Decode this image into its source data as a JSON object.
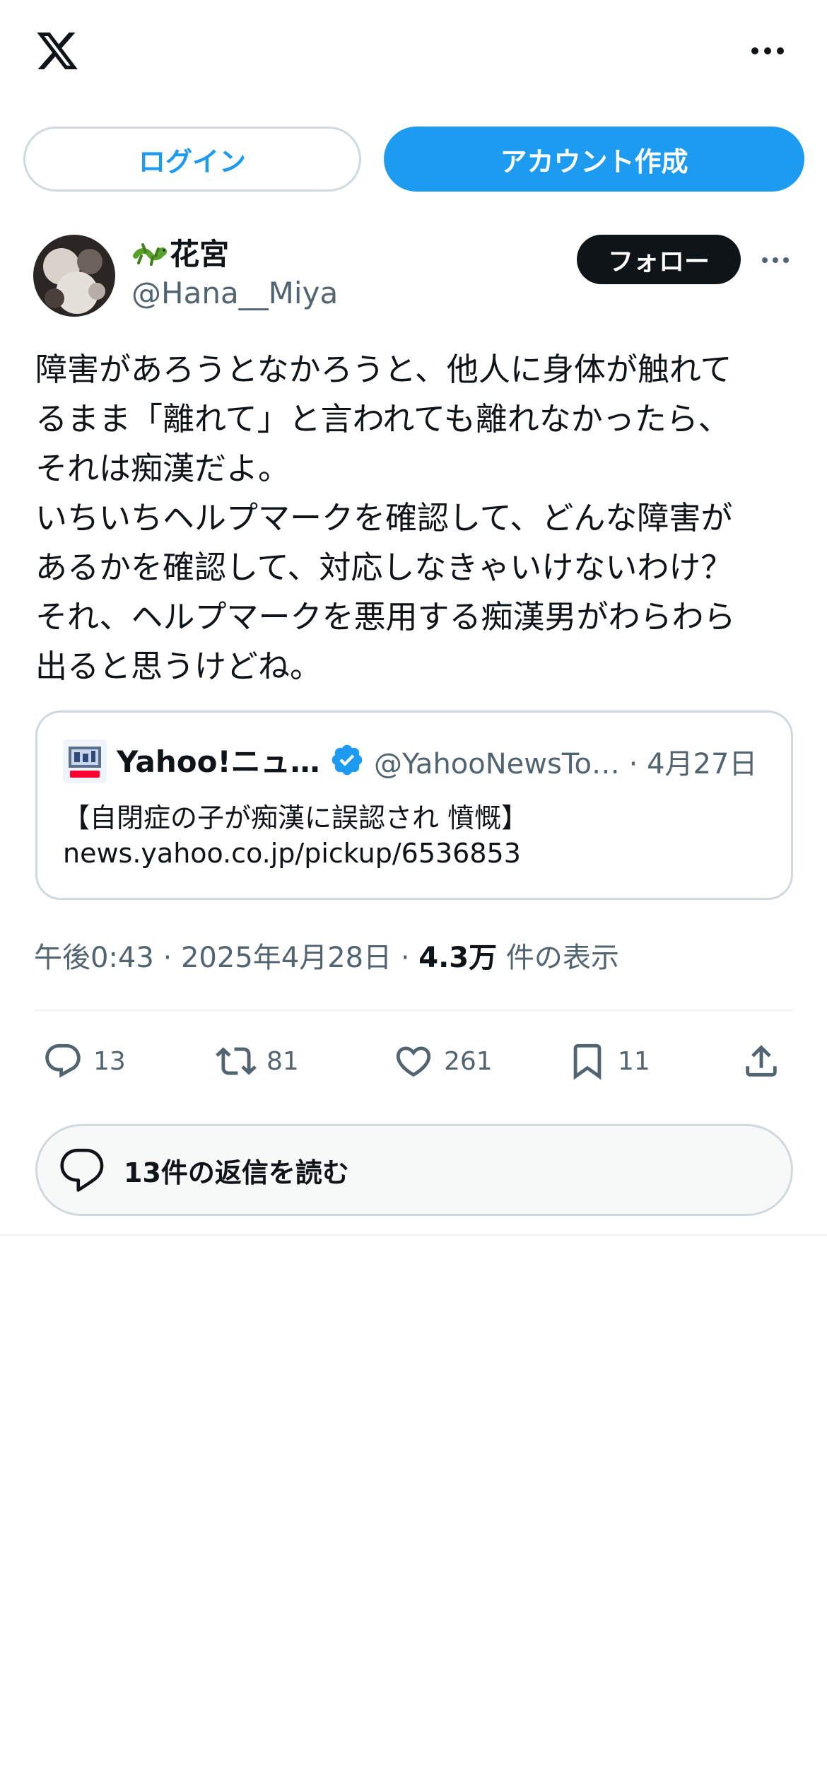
{
  "header": {
    "logo_icon": "x-logo-icon",
    "menu_icon": "more-horizontal-icon"
  },
  "auth": {
    "login_label": "ログイン",
    "signup_label": "アカウント作成"
  },
  "post": {
    "author_name": "花宮",
    "author_emoji": "lizard-emoji",
    "author_handle": "@Hana__Miya",
    "follow_label": "フォロー",
    "text": "障害があろうとなかろうと、他人に身体が触れて\nるまま「離れて」と言われても離れなかったら、\nそれは痴漢だよ。\nいちいちヘルプマークを確認して、どんな障害が\nあるかを確認して、対応しなきゃいけないわけ？\nそれ、ヘルプマークを悪用する痴漢男がわらわら\n出ると思うけどね。",
    "quote": {
      "name": "Yahoo!ニュ…",
      "handle_date": "@YahooNewsTo… · 4月27日",
      "title": "【自閉症の子が痴漢に誤認され 憤慨】",
      "link": "news.yahoo.co.jp/pickup/6536853"
    },
    "meta": {
      "time_date": "午後0:43 · 2025年4月28日 · ",
      "views": "4.3万",
      "views_suffix": " 件の表示"
    },
    "actions": {
      "replies": "13",
      "reposts": "81",
      "likes": "261",
      "bookmarks": "11"
    },
    "read_replies_label": "13件の返信を読む"
  },
  "colors": {
    "accent": "#1d9bf0",
    "text": "#0f1419",
    "secondary": "#536471",
    "border": "#cfd9de"
  }
}
